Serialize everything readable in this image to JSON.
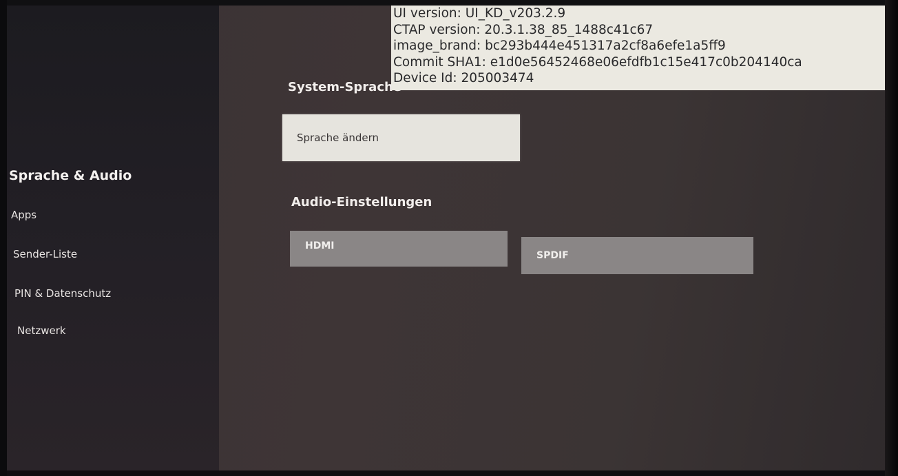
{
  "sidebar": {
    "items": [
      {
        "label": "Sprache & Audio",
        "active": true
      },
      {
        "label": "Apps"
      },
      {
        "label": "Sender-Liste"
      },
      {
        "label": "PIN & Datenschutz"
      },
      {
        "label": "Netzwerk"
      }
    ]
  },
  "main": {
    "system_language": {
      "title": "System-Sprache",
      "change_button": "Sprache ändern"
    },
    "audio": {
      "title": "Audio-Einstellungen",
      "options": [
        "HDMI",
        "SPDIF"
      ]
    }
  },
  "debug_overlay": {
    "lines": [
      "UI version: UI_KD_v203.2.9",
      "CTAP version: 20.3.1.38_85_1488c41c67",
      "image_brand: bc293b444e451317a2cf8a6efe1a5ff9",
      "Commit SHA1: e1d0e56452468e06efdfb1c15e417c0b204140ca",
      "Device Id: 205003474"
    ]
  },
  "colors": {
    "background": "#3b3334",
    "sidebar": "#1f1d22",
    "primary_button": "#e6e4de",
    "secondary_button": "#8a8686",
    "overlay_background": "#ebe9e1"
  }
}
